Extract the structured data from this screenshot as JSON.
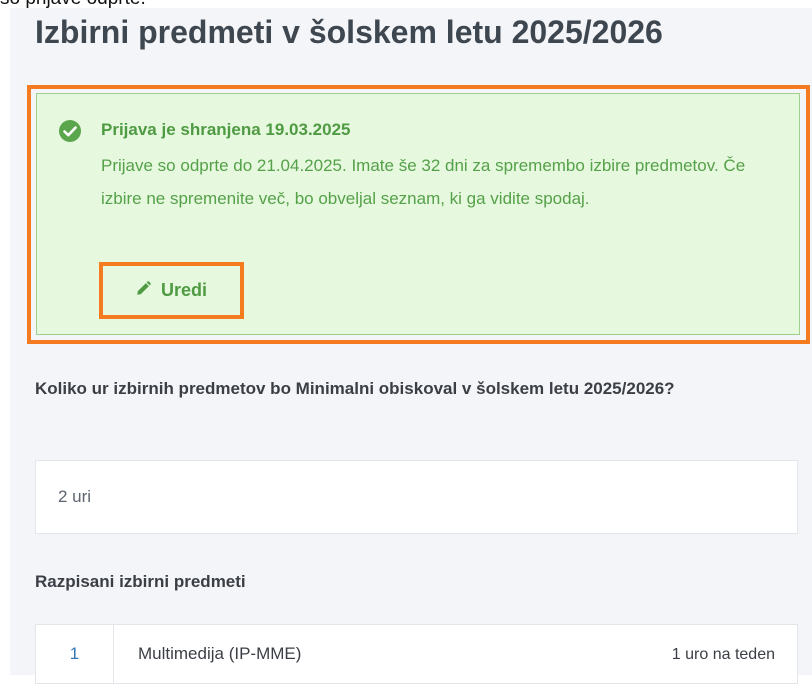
{
  "top_cut_text": "so prijave odprte.",
  "page": {
    "title": "Izbirni predmeti v šolskem letu 2025/2026"
  },
  "alert": {
    "icon": "check-circle-icon",
    "title": "Prijava je shranjena 19.03.2025",
    "message": "Prijave so odprte do 21.04.2025. Imate še 32 dni za spremembo izbire predmetov. Če izbire ne spremenite več, bo obveljal seznam, ki ga vidite spodaj.",
    "edit_label": "Uredi",
    "edit_icon": "pencil-icon",
    "bg_color": "#e6f8de",
    "text_color": "#55a149"
  },
  "highlight_color": "#f47b20",
  "question": {
    "label": "Koliko ur izbirnih predmetov bo Minimalni obiskoval v šolskem letu 2025/2026?",
    "value": "2 uri"
  },
  "subjects": {
    "heading": "Razpisani izbirni predmeti",
    "rows": [
      {
        "num": "1",
        "name": "Multimedija (IP-MME)",
        "hours": "1 uro na teden"
      }
    ]
  }
}
